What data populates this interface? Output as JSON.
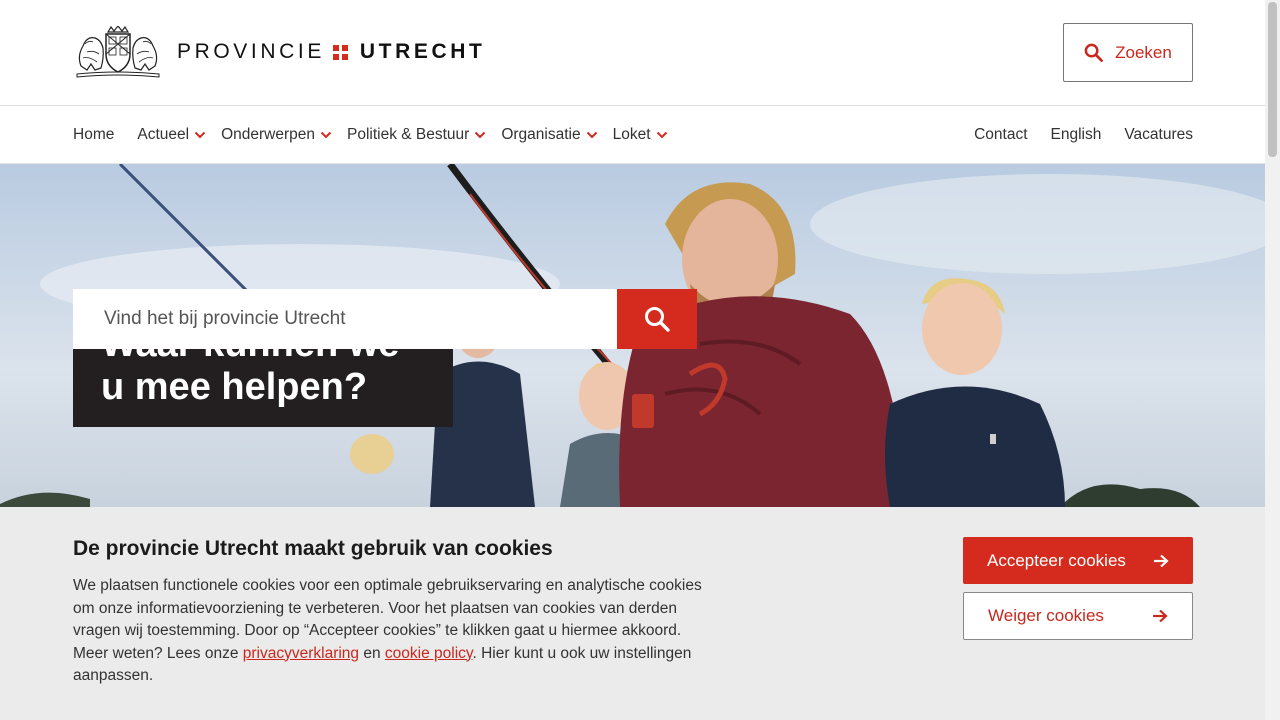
{
  "brand": {
    "name_part1": "PROVINCIE",
    "name_part2": "UTRECHT",
    "accent": "#d52b1e"
  },
  "header": {
    "search_label": "Zoeken",
    "search_icon": "search-icon"
  },
  "nav": {
    "items": [
      {
        "label": "Home",
        "has_dropdown": false
      },
      {
        "label": "Actueel",
        "has_dropdown": true
      },
      {
        "label": "Onderwerpen",
        "has_dropdown": true
      },
      {
        "label": "Politiek & Bestuur",
        "has_dropdown": true
      },
      {
        "label": "Organisatie",
        "has_dropdown": true
      },
      {
        "label": "Loket",
        "has_dropdown": true
      }
    ],
    "right": [
      "Contact",
      "English",
      "Vacatures"
    ]
  },
  "hero": {
    "title_line1": "Waar kunnen we",
    "title_line2": "u mee helpen?",
    "search_placeholder": "Vind het bij provincie Utrecht"
  },
  "cookie": {
    "title": "De provincie Utrecht maakt gebruik van cookies",
    "text_before": "We plaatsen functionele cookies voor een optimale gebruikservaring en analytische cookies om onze informatievoorziening te verbeteren. Voor het plaatsen van cookies van derden vragen wij toestemming. Door op “Accepteer cookies” te klikken gaat u hiermee akkoord. Meer weten? Lees onze ",
    "link1": "privacyverklaring",
    "text_middle": " en ",
    "link2": "cookie policy",
    "text_after": ". Hier kunt u ook uw instellingen aanpassen.",
    "accept_label": "Accepteer cookies",
    "refuse_label": "Weiger cookies"
  }
}
